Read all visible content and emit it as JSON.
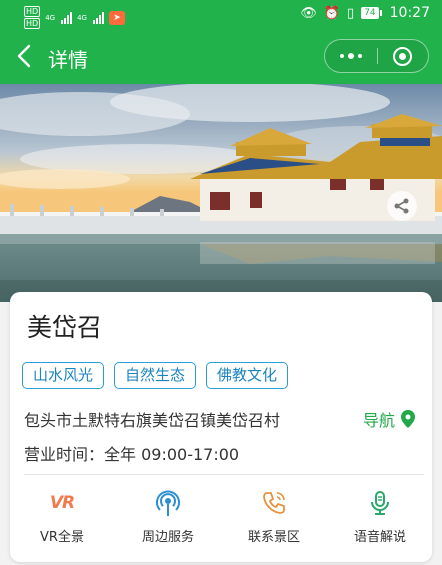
{
  "status_bar": {
    "hd1": "HD",
    "hd2": "HD",
    "signal1": "4G",
    "signal2": "4G",
    "battery": "74",
    "time": "10:27"
  },
  "navbar": {
    "title": "详情"
  },
  "place": {
    "name": "美岱召",
    "tags": [
      "山水风光",
      "自然生态",
      "佛教文化"
    ],
    "address": "包头市土默特右旗美岱召镇美岱召村",
    "nav_label": "导航",
    "hours": "营业时间：全年 09:00-17:00"
  },
  "actions": [
    {
      "label": "VR全景",
      "icon": "vr-icon"
    },
    {
      "label": "周边服务",
      "icon": "broadcast-icon"
    },
    {
      "label": "联系景区",
      "icon": "phone-icon"
    },
    {
      "label": "语音解说",
      "icon": "microphone-icon"
    }
  ],
  "vr_icon_text": "VR",
  "colors": {
    "header_green": "#22b24c",
    "tag_blue": "#2b9fd4",
    "nav_green": "#23a84a",
    "vr_orange": "#f27b4e",
    "service_blue": "#2d8fd1",
    "phone_orange": "#e8913a",
    "mic_green": "#2aa86a"
  }
}
